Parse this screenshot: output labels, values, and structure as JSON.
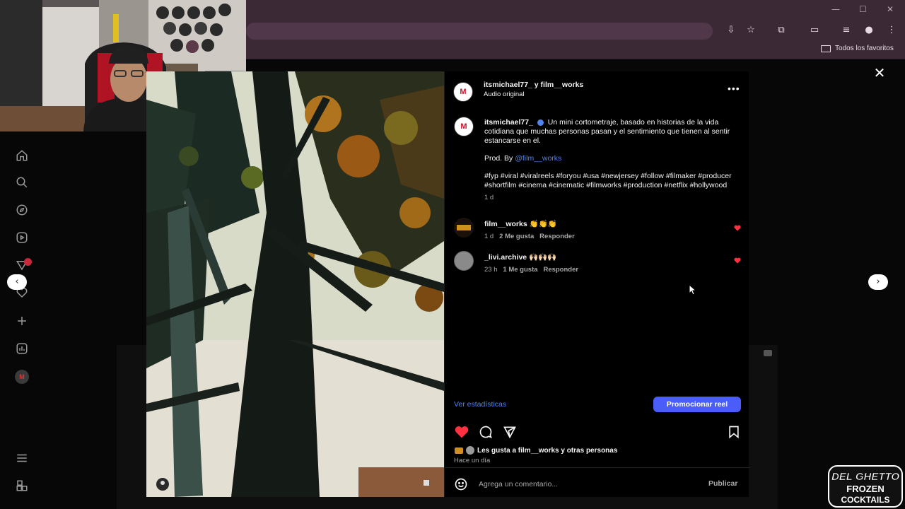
{
  "browser": {
    "bookmark_folder": "Todos los favoritos",
    "window_controls": [
      "—",
      "☐",
      "✕"
    ]
  },
  "post": {
    "header": {
      "authors": "itsmichael77_ y film__works",
      "audio": "Audio original",
      "more_icon": "more-icon"
    },
    "caption": {
      "username": "itsmichael77_",
      "text": "Un mini cortometraje, basado en historias de la vida cotidiana que muchas personas pasan y el sentimiento que tienen al sentir estancarse en el.",
      "prod_prefix": "Prod. By",
      "prod_handle": "@film__works",
      "hashtags": "#fyp #viral #viralreels #foryou #usa #newjersey #follow #filmaker #producer #shortfilm #cinema #cinematic #filmworks #production #netflix #hollywood",
      "time": "1 d"
    },
    "comments": [
      {
        "username": "film__works",
        "text": "👏👏👏",
        "time": "1 d",
        "likes": "2 Me gusta",
        "reply": "Responder"
      },
      {
        "username": "_livi.archive",
        "text": "🙌🏻🙌🏻🙌🏻",
        "time": "23 h",
        "likes": "1 Me gusta",
        "reply": "Responder"
      }
    ],
    "stats_link": "Ver estadísticas",
    "promote_button": "Promocionar reel",
    "likes_text": "Les gusta a film__works y otras personas",
    "posted": "Hace un día",
    "comment_placeholder": "Agrega un comentario...",
    "publish": "Publicar"
  },
  "sidebar": {
    "avatar_letter": "M"
  },
  "logo": {
    "line1": "DEL GHETTO",
    "line2": "FROZEN",
    "line3": "COCKTAILS"
  },
  "colors": {
    "accent": "#4a5df9",
    "link": "#4f83ee",
    "like": "#ff3040",
    "chrome": "#3b2a36"
  }
}
